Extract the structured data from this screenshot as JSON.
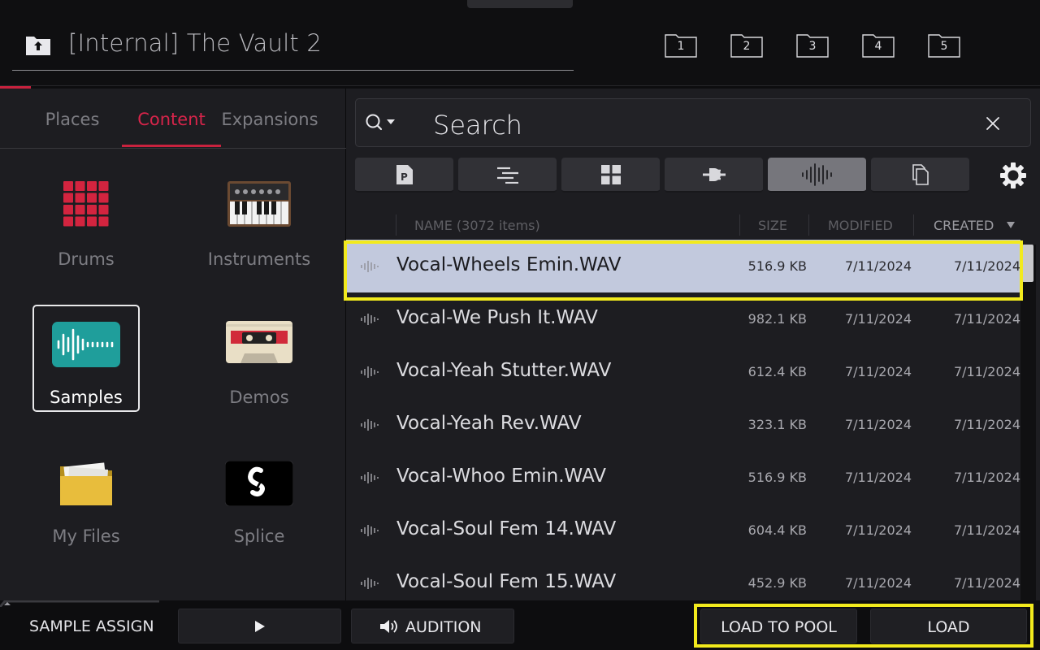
{
  "header": {
    "path": "[Internal] The Vault 2",
    "folder_shortcuts": [
      "1",
      "2",
      "3",
      "4",
      "5"
    ]
  },
  "browser_tabs": {
    "items": [
      "Places",
      "Content",
      "Expansions"
    ],
    "active": "Content"
  },
  "content_tiles": [
    {
      "label": "Drums",
      "icon": "drum-pads-icon"
    },
    {
      "label": "Instruments",
      "icon": "keyboard-icon"
    },
    {
      "label": "Samples",
      "icon": "waveform-icon",
      "selected": true
    },
    {
      "label": "Demos",
      "icon": "cassette-icon"
    },
    {
      "label": "My Files",
      "icon": "folder-icon"
    },
    {
      "label": "Splice",
      "icon": "splice-logo-icon"
    }
  ],
  "search": {
    "placeholder": "Search"
  },
  "filters": [
    {
      "icon": "program-icon",
      "active": false
    },
    {
      "icon": "sequence-icon",
      "active": false
    },
    {
      "icon": "grid-icon",
      "active": false
    },
    {
      "icon": "plugin-icon",
      "active": false
    },
    {
      "icon": "sample-waveform-icon",
      "active": true
    },
    {
      "icon": "copy-icon",
      "active": false
    }
  ],
  "table": {
    "columns": {
      "name": "NAME (3072 items)",
      "size": "SIZE",
      "modified": "MODIFIED",
      "created": "CREATED"
    },
    "sort": {
      "column": "created",
      "direction": "descending"
    },
    "rows": [
      {
        "name": "Vocal-Wheels Emin.WAV",
        "size": "516.9 KB",
        "modified": "7/11/2024",
        "created": "7/11/2024",
        "selected": true
      },
      {
        "name": "Vocal-We Push It.WAV",
        "size": "982.1 KB",
        "modified": "7/11/2024",
        "created": "7/11/2024"
      },
      {
        "name": "Vocal-Yeah Stutter.WAV",
        "size": "612.4 KB",
        "modified": "7/11/2024",
        "created": "7/11/2024"
      },
      {
        "name": "Vocal-Yeah Rev.WAV",
        "size": "323.1 KB",
        "modified": "7/11/2024",
        "created": "7/11/2024"
      },
      {
        "name": "Vocal-Whoo Emin.WAV",
        "size": "516.9 KB",
        "modified": "7/11/2024",
        "created": "7/11/2024"
      },
      {
        "name": "Vocal-Soul Fem 14.WAV",
        "size": "604.4 KB",
        "modified": "7/11/2024",
        "created": "7/11/2024"
      },
      {
        "name": "Vocal-Soul Fem 15.WAV",
        "size": "452.9 KB",
        "modified": "7/11/2024",
        "created": "7/11/2024"
      }
    ]
  },
  "bottom_bar": {
    "sample_assign": "SAMPLE ASSIGN",
    "audition": "AUDITION",
    "load_to_pool": "LOAD TO POOL",
    "load": "LOAD"
  },
  "colors": {
    "accent": "#c8223e",
    "highlight": "#f2ea1d",
    "selected_row": "#c2c9dd",
    "panel": "#1d1d21"
  }
}
